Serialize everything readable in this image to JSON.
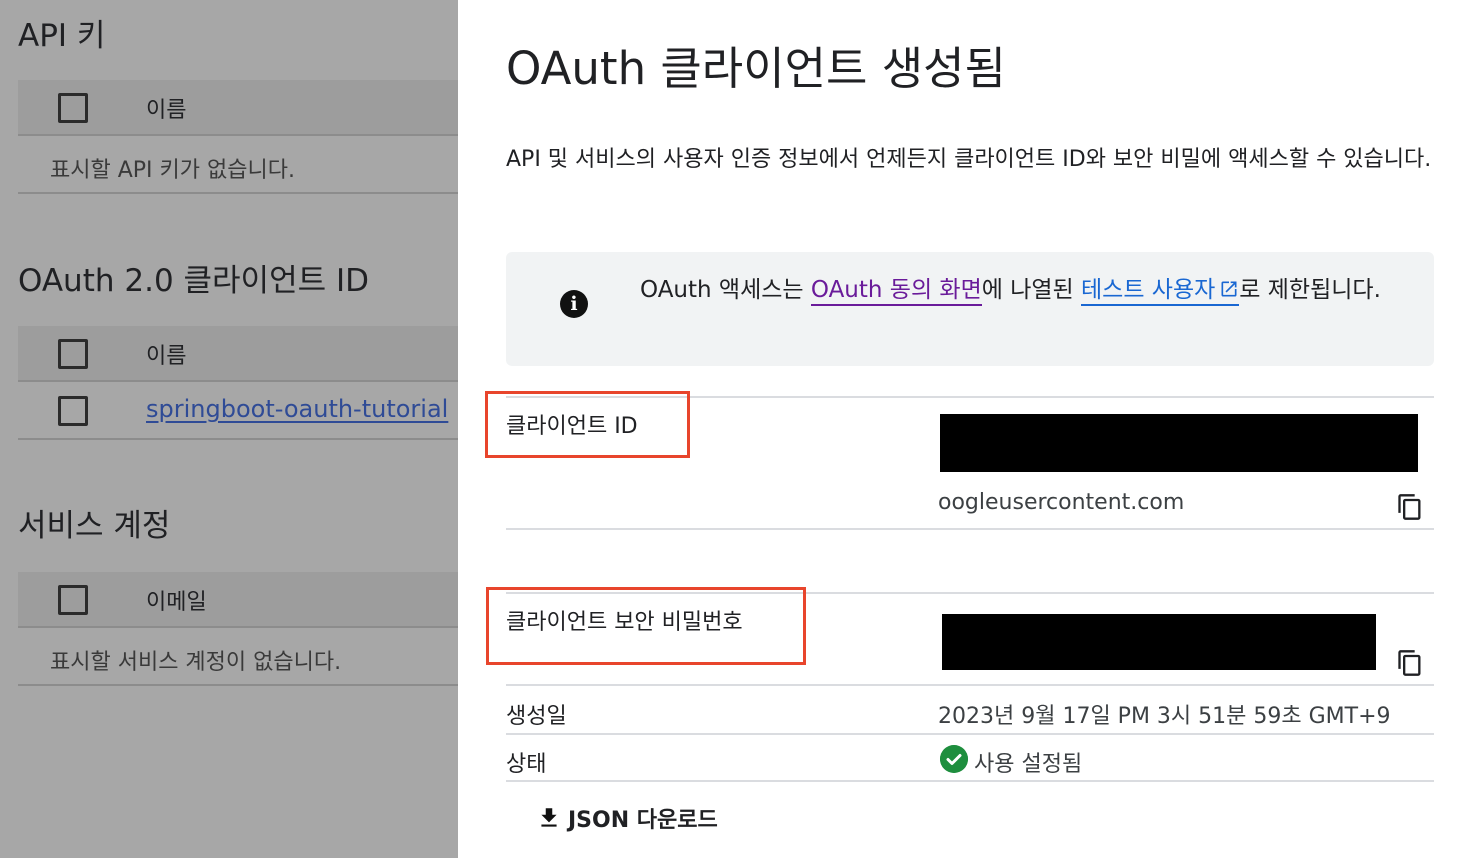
{
  "left": {
    "api_keys": {
      "heading": "API 키",
      "column": "이름",
      "empty": "표시할 API 키가 없습니다."
    },
    "oauth": {
      "heading": "OAuth 2.0 클라이언트 ID",
      "column": "이름",
      "rows": [
        {
          "name": "springboot-oauth-tutorial"
        }
      ]
    },
    "service_accounts": {
      "heading": "서비스 계정",
      "column": "이메일",
      "empty": "표시할 서비스 계정이 없습니다."
    }
  },
  "dialog": {
    "title": "OAuth 클라이언트 생성됨",
    "description": "API 및 서비스의 사용자 인증 정보에서 언제든지 클라이언트 ID와 보안 비밀에 액세스할 수 있습니다.",
    "info": {
      "prefix": "OAuth 액세스는 ",
      "link1": "OAuth 동의 화면",
      "mid": "에 나열된 ",
      "link2": "테스트 사용자",
      "suffix": "로 제한됩니다."
    },
    "client_id": {
      "label": "클라이언트 ID",
      "value_tail": "oogleusercontent.com"
    },
    "client_secret": {
      "label": "클라이언트 보안 비밀번호"
    },
    "created": {
      "label": "생성일",
      "value": "2023년 9월 17일 PM 3시 51분 59초 GMT+9"
    },
    "status": {
      "label": "상태",
      "value": "사용 설정됨"
    },
    "download_label": "JSON 다운로드"
  },
  "colors": {
    "highlight": "#e8452c",
    "status_green": "#1e8e3e",
    "link_purple": "#6a1b9a",
    "link_blue": "#1967d2"
  },
  "icons": [
    "checkbox-icon",
    "info-icon",
    "external-link-icon",
    "copy-icon",
    "check-circle-icon",
    "download-icon"
  ]
}
